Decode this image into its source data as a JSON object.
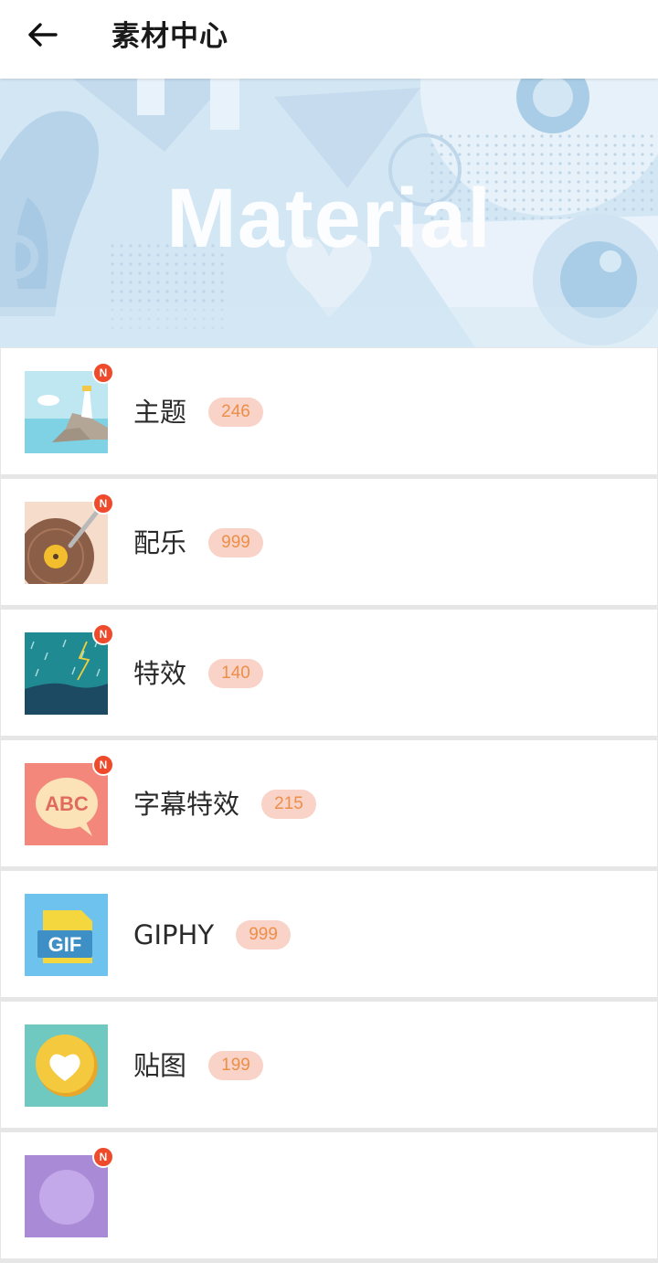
{
  "header": {
    "title": "素材中心",
    "back_icon": "arrow-left-icon"
  },
  "banner": {
    "text": "Material"
  },
  "new_badge_text": "N",
  "items": [
    {
      "label": "主题",
      "count": "246",
      "icon": "lighthouse-theme-icon",
      "is_new": true
    },
    {
      "label": "配乐",
      "count": "999",
      "icon": "vinyl-record-music-icon",
      "is_new": true
    },
    {
      "label": "特效",
      "count": "140",
      "icon": "rain-lightning-effect-icon",
      "is_new": true
    },
    {
      "label": "字幕特效",
      "count": "215",
      "icon": "abc-speech-bubble-icon",
      "is_new": true
    },
    {
      "label": "GIPHY",
      "count": "999",
      "icon": "gif-file-icon",
      "is_new": false
    },
    {
      "label": "贴图",
      "count": "199",
      "icon": "heart-sticker-icon",
      "is_new": false
    },
    {
      "label": "",
      "count": "",
      "icon": "purple-circle-icon",
      "is_new": true
    }
  ],
  "colors": {
    "badge_bg": "#f9d2c8",
    "badge_text": "#ec8f49",
    "new_dot": "#ee4a2b",
    "banner_bg": "#cfe3f2"
  }
}
